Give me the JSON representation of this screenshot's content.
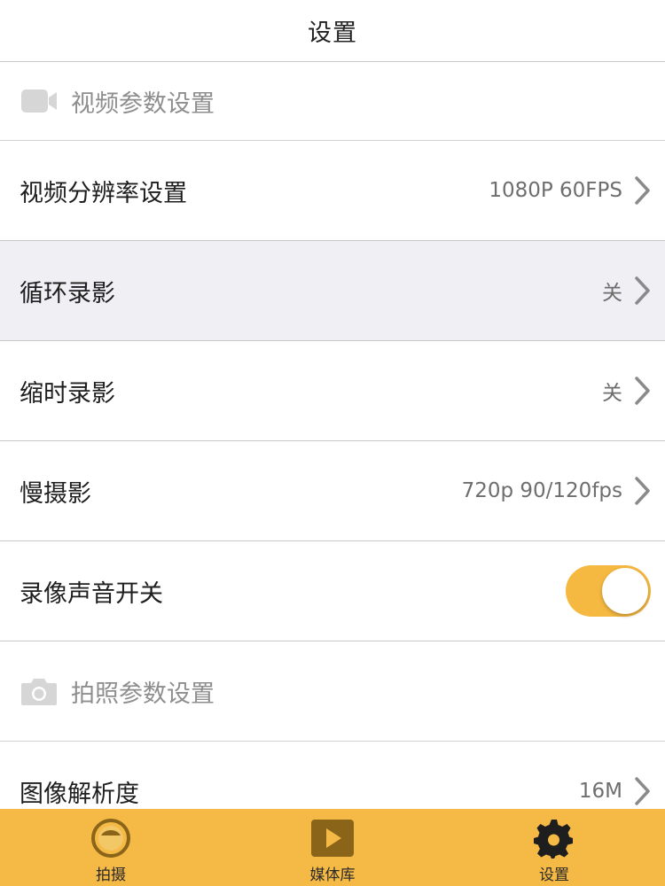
{
  "header": {
    "title": "设置"
  },
  "video_section": {
    "icon": "video-camera-icon",
    "title": "视频参数设置",
    "rows": [
      {
        "label": "视频分辨率设置",
        "value": "1080P 60FPS"
      },
      {
        "label": "循环录影",
        "value": "关"
      },
      {
        "label": "缩时录影",
        "value": "关"
      },
      {
        "label": "慢摄影",
        "value": "720p 90/120fps"
      }
    ],
    "audio_toggle": {
      "label": "录像声音开关",
      "on": true
    }
  },
  "photo_section": {
    "icon": "camera-icon",
    "title": "拍照参数设置",
    "rows": [
      {
        "label": "图像解析度",
        "value": "16M"
      }
    ]
  },
  "tabbar": {
    "items": [
      {
        "label": "拍摄",
        "icon": "lens-icon"
      },
      {
        "label": "媒体库",
        "icon": "play-icon"
      },
      {
        "label": "设置",
        "icon": "gear-icon"
      }
    ]
  },
  "colors": {
    "accent": "#f5b945",
    "toggle_on": "#f5b941",
    "section_text": "#8e8e8e",
    "highlight_row": "#efeff4"
  }
}
